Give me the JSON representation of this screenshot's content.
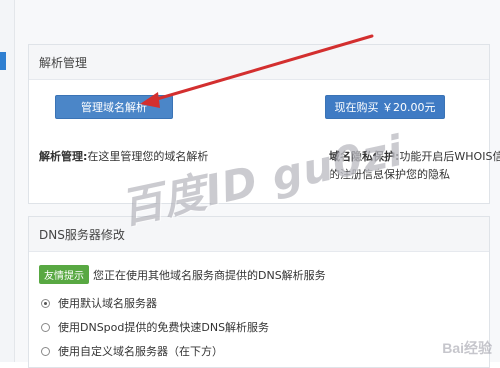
{
  "panel_dns_management": {
    "title": "解析管理",
    "manage_button": "管理域名解析",
    "buy_button": "现在购买 ￥20.00元",
    "desc_left_label": "解析管理:",
    "desc_left_text": "在这里管理您的域名解析",
    "desc_right_label": "域名隐私保护:",
    "desc_right_text": "功能开启后WHOIS信息中",
    "desc_right_text2": "的注册信息保护您的隐私"
  },
  "panel_dns_server": {
    "title": "DNS服务器修改",
    "notice_tag": "友情提示",
    "notice_text": "您正在使用其他域名服务商提供的DNS解析服务",
    "options": [
      {
        "label": "使用默认域名服务器",
        "selected": true
      },
      {
        "label": "使用DNSpod提供的免费快速DNS解析服务",
        "selected": false
      },
      {
        "label": "使用自定义域名服务器（在下方）",
        "selected": false
      }
    ]
  },
  "watermark": "百度ID gu0zi",
  "logo": "Bai经验",
  "colors": {
    "accent": "#4b86c8",
    "arrow": "#d32f2f",
    "tag": "#58a842"
  }
}
